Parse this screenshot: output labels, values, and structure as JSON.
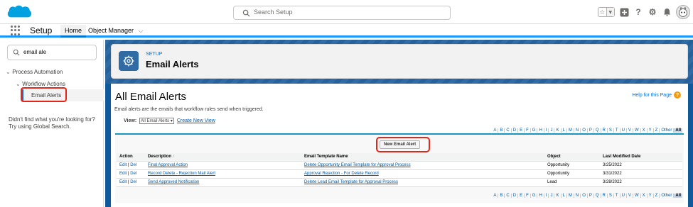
{
  "topbar": {
    "search_placeholder": "Search Setup",
    "brand_color": "#00a1e0"
  },
  "nav": {
    "app_name": "Setup",
    "tabs": [
      {
        "label": "Home"
      },
      {
        "label": "Object Manager"
      }
    ]
  },
  "sidebar": {
    "quick_find_value": "email ale",
    "tree": [
      {
        "label": "Process Automation"
      },
      {
        "label": "Workflow Actions"
      },
      {
        "label": "Email Alerts"
      }
    ],
    "not_found_line1": "Didn't find what you're looking for?",
    "not_found_line2": "Try using Global Search."
  },
  "header": {
    "eyebrow": "SETUP",
    "title": "Email Alerts"
  },
  "content": {
    "heading": "All Email Alerts",
    "help_link": "Help for this Page",
    "description": "Email alerts are the emails that workflow rules send when triggered.",
    "view_label": "View:",
    "view_selected": "All Email Alerts",
    "create_view": "Create New View",
    "az_letters": [
      "A",
      "B",
      "C",
      "D",
      "E",
      "F",
      "G",
      "H",
      "I",
      "J",
      "K",
      "L",
      "M",
      "N",
      "O",
      "P",
      "Q",
      "R",
      "S",
      "T",
      "U",
      "V",
      "W",
      "X",
      "Y",
      "Z",
      "Other",
      "All"
    ],
    "new_button": "New Email Alert",
    "columns": [
      "Action",
      "Description",
      "Email Template Name",
      "Object",
      "Last Modified Date"
    ],
    "sort_indicator": "↑",
    "rows": [
      {
        "edit": "Edit",
        "del": "Del",
        "description": "Final Approval Action",
        "template": "Delete Opportunity Email Template for Approval Process",
        "object": "Opportunity",
        "date": "3/25/2022"
      },
      {
        "edit": "Edit",
        "del": "Del",
        "description": "Record Delete - Rejection Mail Alert",
        "template": "Approval Rejection - For Delete Record",
        "object": "Opportunity",
        "date": "3/31/2022"
      },
      {
        "edit": "Edit",
        "del": "Del",
        "description": "Send Approved Notification",
        "template": "Delete Lead Email Template for Approval Process",
        "object": "Lead",
        "date": "3/28/2022"
      }
    ]
  }
}
